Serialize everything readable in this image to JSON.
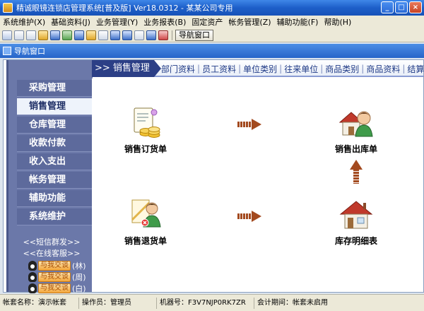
{
  "window": {
    "title": "精诚眼镜连锁店管理系统[普及版] Ver18.0312 - 某某公司专用",
    "min": "_",
    "max": "□",
    "close": "×"
  },
  "menubar": [
    {
      "label": "系统维护(X)"
    },
    {
      "label": "基础资料(J)"
    },
    {
      "label": "业务管理(Y)"
    },
    {
      "label": "业务报表(B)"
    },
    {
      "label": "固定资产"
    },
    {
      "label": "帐务管理(Z)"
    },
    {
      "label": "辅助功能(F)"
    },
    {
      "label": "帮助(H)"
    }
  ],
  "toolbar": {
    "nav_button_label": "导航窗口"
  },
  "inner_window": {
    "title": "导航窗口"
  },
  "sidebar": {
    "items": [
      {
        "label": "采购管理"
      },
      {
        "label": "销售管理"
      },
      {
        "label": "仓库管理"
      },
      {
        "label": "收款付款"
      },
      {
        "label": "收入支出"
      },
      {
        "label": "帐务管理"
      },
      {
        "label": "辅助功能"
      },
      {
        "label": "系统维护"
      }
    ],
    "active_index": 1,
    "sms_link": "<<短信群发>>",
    "service_link": "<<在线客服>>",
    "qq_button_text": "与我交谈",
    "qq_contacts": [
      {
        "name": "(林)"
      },
      {
        "name": "(周)"
      },
      {
        "name": "(白)"
      }
    ]
  },
  "tabs": {
    "section": ">> 销售管理",
    "links": [
      "部门资料",
      "员工资料",
      "单位类别",
      "往来单位",
      "商品类别",
      "商品资料",
      "结算方式"
    ]
  },
  "functions": {
    "sales_order": "销售订货单",
    "sales_outbound": "销售出库单",
    "sales_return": "销售退货单",
    "inventory_detail": "库存明细表"
  },
  "status": {
    "account_name": "帐套名称：演示帐套",
    "operator": "操作员：管理员",
    "machine_no": "机器号：F3V7NJP0RK7ZR",
    "accounting_period": "会计期间：帐套未启用"
  }
}
